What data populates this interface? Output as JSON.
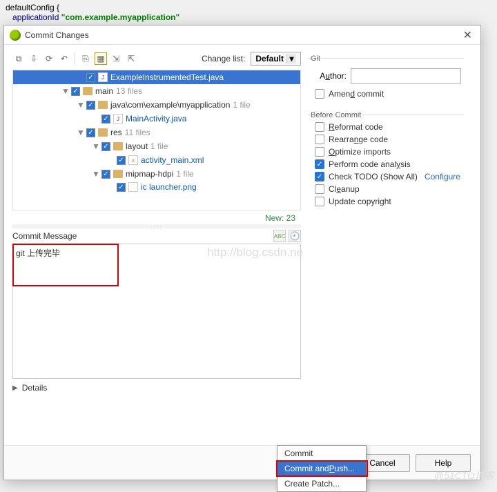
{
  "bg_code": {
    "line1": "defaultConfig {",
    "line2_key": "applicationId",
    "line2_val": "\"com.example.myapplication\""
  },
  "dialog": {
    "title": "Commit Changes",
    "change_list_label": "Change list:",
    "change_list_value": "Default",
    "tree": {
      "selected": "ExampleInstrumentedTest.java",
      "rows": [
        {
          "label": "main",
          "count": "13 files"
        },
        {
          "label": "java\\com\\example\\myapplication",
          "count": "1 file"
        },
        {
          "label": "MainActivity.java"
        },
        {
          "label": "res",
          "count": "11 files"
        },
        {
          "label": "layout",
          "count": "1 file"
        },
        {
          "label": "activity_main.xml"
        },
        {
          "label": "mipmap-hdpi",
          "count": "1 file"
        },
        {
          "label": "ic launcher.png"
        }
      ],
      "new_count": "New: 23"
    },
    "commit_msg_label": "Commit Message",
    "commit_msg_value": "git 上传完毕",
    "details_label": "Details",
    "git": {
      "legend": "Git",
      "author_label_pre": "A",
      "author_label_ul": "u",
      "author_label_post": "thor:",
      "author_value": "",
      "amend_pre": "Amen",
      "amend_ul": "d",
      "amend_post": " commit"
    },
    "before": {
      "legend": "Before Commit",
      "items": [
        {
          "label_pre": "",
          "ul": "R",
          "label_post": "eformat code",
          "checked": false
        },
        {
          "label_pre": "Rearra",
          "ul": "n",
          "label_post": "ge code",
          "checked": false
        },
        {
          "label_pre": "",
          "ul": "O",
          "label_post": "ptimize imports",
          "checked": false
        },
        {
          "label_pre": "Perform code anal",
          "ul": "y",
          "label_post": "sis",
          "checked": true
        },
        {
          "label_pre": "Check TODO (Show All)",
          "ul": "",
          "label_post": "",
          "checked": true,
          "link": "Configure"
        },
        {
          "label_pre": "Cl",
          "ul": "e",
          "label_post": "anup",
          "checked": false
        },
        {
          "label_pre": "Update copyri",
          "ul": "g",
          "label_post": "ht",
          "checked": false
        }
      ]
    },
    "buttons": {
      "commit": "Commit",
      "cancel": "Cancel",
      "help": "Help"
    },
    "dropdown": {
      "i1": "Commit",
      "i2_pre": "Commit and ",
      "i2_ul": "P",
      "i2_post": "ush...",
      "i3": "Create Patch..."
    }
  },
  "watermark_url": "http://blog.csdn.ne",
  "watermark_br": "@51CTO博客"
}
